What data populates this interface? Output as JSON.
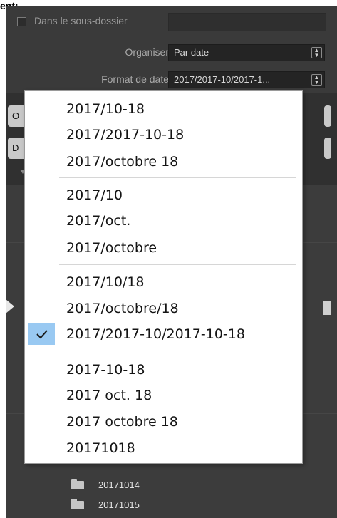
{
  "top_cut_label": "ent:",
  "options": {
    "subfolder_label": "Dans le sous-dossier",
    "subfolder_value": "",
    "organize_label": "Organiser",
    "organize_value": "Par date",
    "date_format_label": "Format de date",
    "date_format_value": "2017/2017-10/2017-1..."
  },
  "side_buttons": [
    "O",
    "D"
  ],
  "menu": {
    "groups": [
      [
        "2017/10-18",
        "2017/2017-10-18",
        "2017/octobre 18"
      ],
      [
        "2017/10",
        "2017/oct.",
        "2017/octobre"
      ],
      [
        "2017/10/18",
        "2017/octobre/18",
        "2017/2017-10/2017-10-18"
      ],
      [
        "2017-10-18",
        "2017 oct. 18",
        "2017 octobre 18",
        "20171018"
      ]
    ],
    "selected": "2017/2017-10/2017-10-18",
    "selected_highlight": "#99c9f2"
  },
  "folders": [
    "20171014",
    "20171015"
  ],
  "colors": {
    "panel_bg": "#3a3a3a",
    "menu_bg": "#ffffff",
    "select_bg": "#242424"
  }
}
